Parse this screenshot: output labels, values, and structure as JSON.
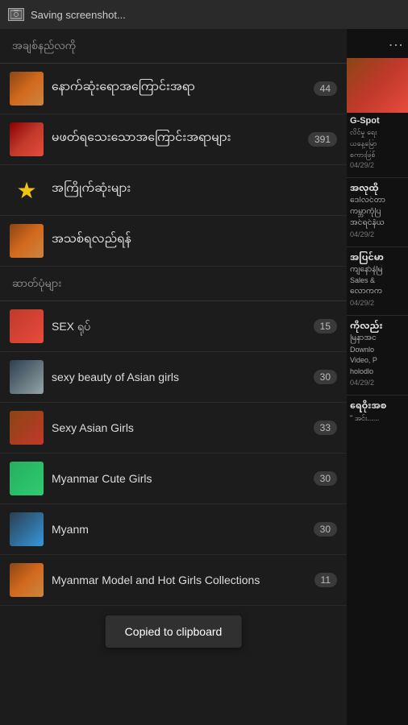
{
  "topbar": {
    "title": "Saving screenshot..."
  },
  "left": {
    "section1_label": "အချစ်နည်လကို",
    "items_fav": [
      {
        "id": "item-fav-1",
        "type": "avatar",
        "avatar_class": "av1",
        "text": "နောက်ဆုံးရောအကြောင်းအရာ",
        "count": "44"
      },
      {
        "id": "item-fav-2",
        "type": "avatar",
        "avatar_class": "av2",
        "text": "မဖတ်ရသေးသောအကြောင်းအရာများ",
        "count": "391"
      },
      {
        "id": "item-fav-3",
        "type": "star",
        "text": "အကြိုက်ဆုံးများ",
        "count": ""
      },
      {
        "id": "item-fav-4",
        "type": "avatar",
        "avatar_class": "av4",
        "text": "အသစ်ရလည်ရန်",
        "count": ""
      }
    ],
    "section2_label": "ဆာတ်ပုံများ",
    "items_channels": [
      {
        "id": "item-ch-1",
        "avatar_class": "av5",
        "text": "SEX ရုပ်",
        "count": "15"
      },
      {
        "id": "item-ch-2",
        "avatar_class": "av6",
        "text": "sexy beauty of Asian girls",
        "count": "30"
      },
      {
        "id": "item-ch-3",
        "avatar_class": "av7",
        "text": "Sexy Asian Girls",
        "count": "33"
      },
      {
        "id": "item-ch-4",
        "avatar_class": "av8",
        "text": "Myanmar Cute Girls",
        "count": "30"
      },
      {
        "id": "item-ch-5",
        "avatar_class": "av9",
        "text": "Myanm",
        "count": "30"
      },
      {
        "id": "item-ch-6",
        "avatar_class": "av1",
        "text": "Myanmar Model and Hot Girls Collections",
        "count": "11"
      }
    ],
    "toast": "Copied to clipboard"
  },
  "right": {
    "menu_icon": "⋮",
    "entries": [
      {
        "id": "r1",
        "name": "G-Spot",
        "lines": [
          "လိင်မှု ရေး",
          "ယနေ့မြော",
          "စကားဖြစ်"
        ],
        "date": "04/29/2"
      },
      {
        "id": "r2",
        "name": "အလုထို",
        "lines": [
          "ဒေါ်လင်တာ",
          "ကမ္ဘာကိုပြ",
          "အင်ရင်နိယ"
        ],
        "date": "04/29/2"
      },
      {
        "id": "r3",
        "name": "အပြင်မာ",
        "lines": [
          "ကျနော်နဲမြ",
          "Sales &",
          "လောကက"
        ],
        "date": "04/29/2"
      },
      {
        "id": "r4",
        "name": "ကိုလည်း",
        "lines": [
          "မြနာအင",
          "Downlo",
          "Video, P",
          "holodlo"
        ],
        "date": "04/29/2"
      },
      {
        "id": "r5",
        "name": "ရေဝိုးအစ",
        "lines": [
          "\" အင်း......"
        ],
        "date": ""
      }
    ]
  }
}
